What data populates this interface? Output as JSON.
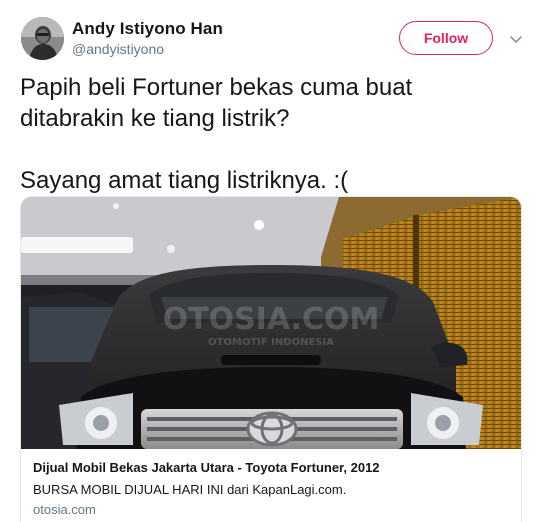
{
  "author": {
    "name": "Andy Istiyono Han",
    "handle": "@andyistiyono"
  },
  "follow_button": {
    "label": "Follow"
  },
  "tweet": {
    "lines": [
      "Papih beli Fortuner bekas cuma buat",
      "ditabrakin ke tiang listrik?",
      "Sayang amat tiang listriknya. :("
    ]
  },
  "card": {
    "title": "Dijual Mobil Bekas Jakarta Utara - Toyota Fortuner, 2012",
    "description": "BURSA MOBIL DIJUAL HARI INI dari KapanLagi.com.",
    "domain": "otosia.com",
    "watermark": "OTOSIA.COM",
    "watermark_sub": "OTOMOTIF INDONESIA"
  },
  "icons": {
    "more": "chevron-down-icon"
  },
  "colors": {
    "follow_accent": "#e0245e",
    "secondary_text": "#657786",
    "primary_text": "#14171a",
    "card_border": "#e1e8ed"
  }
}
